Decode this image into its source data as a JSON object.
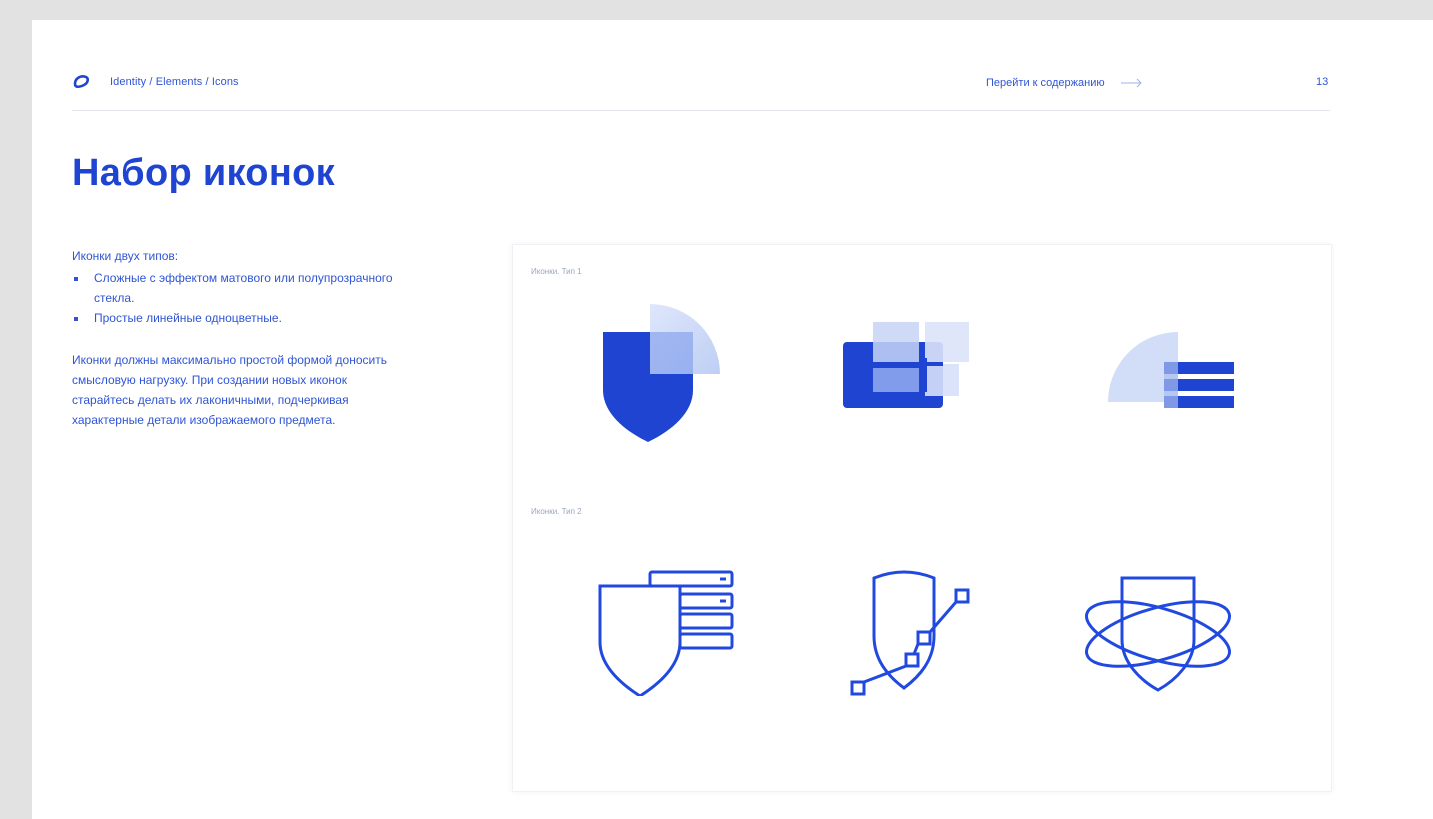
{
  "header": {
    "breadcrumb": "Identity / Elements / Icons",
    "toc_link": "Перейти к содержанию",
    "page_number": "13"
  },
  "title": "Набор иконок",
  "description": {
    "intro": "Иконки двух типов:",
    "bullets": [
      "Сложные с эффектом матового или полупрозрачного стекла.",
      "Простые линейные одноцветные."
    ],
    "body": "Иконки должны максимально простой формой доносить смысловую нагрузку. При создании новых иконок старайтесь делать их лаконичными, подчеркивая характерные детали изображаемого предмета."
  },
  "panel": {
    "type1_label": "Иконки. Тип 1",
    "type2_label": "Иконки. Тип 2",
    "type1_icons": [
      "shield-glass-icon",
      "window-glass-icon",
      "server-glass-icon"
    ],
    "type2_icons": [
      "shield-server-line-icon",
      "shield-network-line-icon",
      "shield-orbit-line-icon"
    ]
  },
  "colors": {
    "accent": "#1f44d1",
    "icon_blue": "#2149e0",
    "glass_light": "#c9d6f7",
    "background": "#e2e2e2"
  }
}
